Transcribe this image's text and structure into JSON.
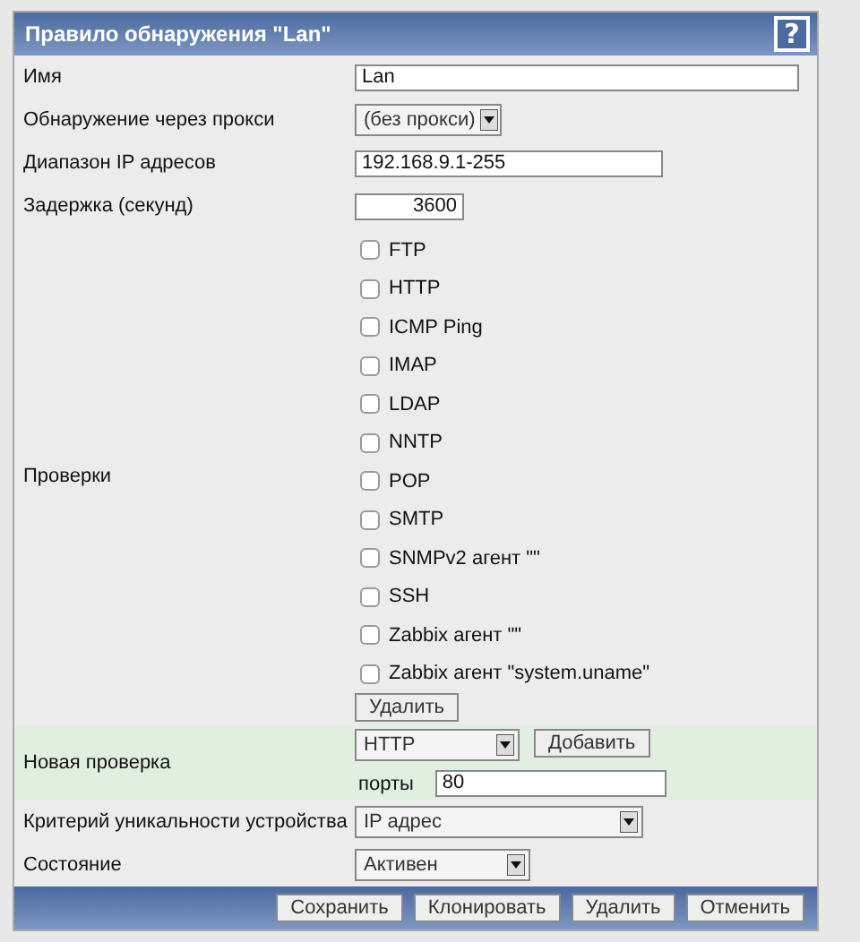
{
  "window": {
    "title": "Правило обнаружения \"Lan\"",
    "help": "?"
  },
  "fields": [
    {
      "kind": "text",
      "label": "Имя",
      "value": "Lan"
    },
    {
      "kind": "select",
      "label": "Обнаружение через прокси",
      "value": "(без прокси)"
    },
    {
      "kind": "text",
      "label": "Диапазон IP адресов",
      "value": "192.168.9.1-255"
    },
    {
      "kind": "number",
      "label": "Задержка (секунд)",
      "value": "3600"
    }
  ],
  "checks": {
    "label": "Проверки",
    "items": [
      {
        "label": "FTP",
        "checked": false
      },
      {
        "label": "HTTP",
        "checked": false
      },
      {
        "label": "ICMP Ping",
        "checked": false
      },
      {
        "label": "IMAP",
        "checked": false
      },
      {
        "label": "LDAP",
        "checked": false
      },
      {
        "label": "NNTP",
        "checked": false
      },
      {
        "label": "POP",
        "checked": false
      },
      {
        "label": "SMTP",
        "checked": false
      },
      {
        "label": "SNMPv2 агент \"\"",
        "checked": false
      },
      {
        "label": "SSH",
        "checked": false
      },
      {
        "label": "Zabbix агент \"\"",
        "checked": false
      },
      {
        "label": "Zabbix агент \"system.uname\"",
        "checked": false
      }
    ],
    "remove_button": "Удалить"
  },
  "new_check": {
    "label": "Новая проверка",
    "type": "HTTP",
    "add_button": "Добавить",
    "ports_label": "порты",
    "ports": "80"
  },
  "bottom_fields": [
    {
      "kind": "select",
      "label": "Критерий уникальности устройства",
      "value": "IP адрес"
    },
    {
      "kind": "select",
      "label": "Состояние",
      "value": "Активен"
    }
  ],
  "buttons": [
    "Сохранить",
    "Клонировать",
    "Удалить",
    "Отменить"
  ]
}
